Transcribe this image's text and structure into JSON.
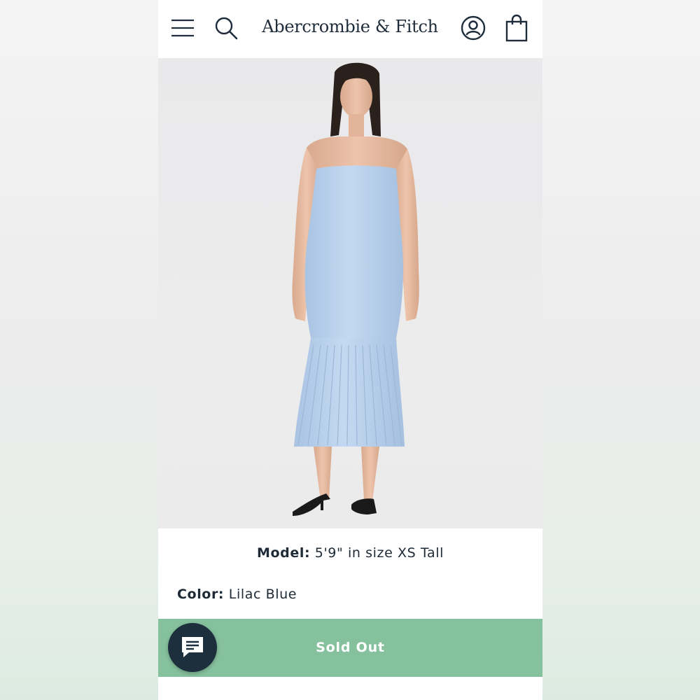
{
  "header": {
    "brand": "Abercrombie & Fitch",
    "icons": {
      "menu": "hamburger-menu-icon",
      "search": "search-icon",
      "account": "account-icon",
      "bag": "shopping-bag-icon"
    }
  },
  "product": {
    "image": "model-wearing-strapless-pleated-midi-dress",
    "model_label": "Model:",
    "model_value": "5'9\" in size XS Tall",
    "color_label": "Color:",
    "color_value": "Lilac Blue",
    "cta_label": "Sold Out"
  },
  "chat": {
    "icon": "chat-icon"
  },
  "colors": {
    "cta_background": "#86c19e",
    "chat_background": "#1d2f3d",
    "brand_text": "#1f2c3a",
    "dress": "#b8d0ec"
  }
}
